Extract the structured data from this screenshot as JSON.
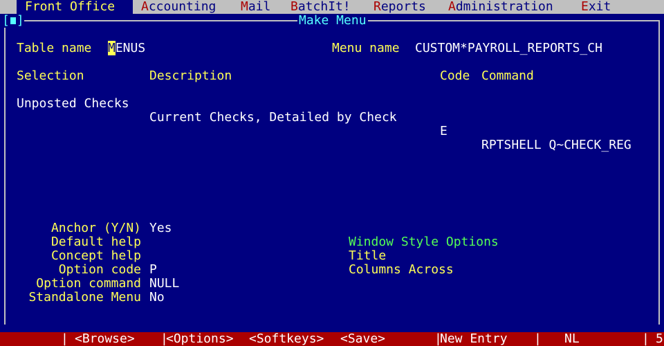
{
  "menubar": {
    "items": [
      {
        "hotkey": "F",
        "rest": "ront Office"
      },
      {
        "hotkey": "A",
        "rest": "ccounting"
      },
      {
        "hotkey": "M",
        "rest": "ail"
      },
      {
        "hotkey": "B",
        "rest": "atchIt!"
      },
      {
        "hotkey": "R",
        "rest": "eports"
      },
      {
        "hotkey": "A",
        "rest": "dministration"
      },
      {
        "hotkey": "E",
        "rest": "xit"
      }
    ]
  },
  "window": {
    "title": "Make Menu",
    "close_left": "[",
    "close_right": "]"
  },
  "form": {
    "table_name_label": "Table name",
    "table_name_cursor": "M",
    "table_name_rest": "ENUS",
    "menu_name_label": "Menu name",
    "menu_name_value": "CUSTOM*PAYROLL_REPORTS_CH"
  },
  "grid": {
    "headers": {
      "selection": "Selection",
      "description": "Description",
      "code": "Code",
      "command": "Command"
    },
    "rows": [
      {
        "selection": "Unposted Checks",
        "description": "Current Checks, Detailed by Check",
        "code": "E",
        "command": "RPTSHELL Q~CHECK_REG"
      }
    ]
  },
  "options": {
    "anchor_label": "Anchor (Y/N)",
    "anchor_value": "Yes",
    "default_help_label": "Default help",
    "default_help_value": "",
    "concept_help_label": "Concept help",
    "concept_help_value": "",
    "option_code_label": "Option code",
    "option_code_value": "P",
    "option_command_label": "Option command",
    "option_command_value": "NULL",
    "standalone_label": "Standalone Menu",
    "standalone_value": "No"
  },
  "window_style": {
    "heading": "Window Style Options",
    "title_label": "Title",
    "columns_label": "Columns Across"
  },
  "statusbar": {
    "browse": "<Browse>",
    "options": "<Options>",
    "softkeys": "<Softkeys>",
    "save": "<Save>",
    "mode": "New Entry",
    "locale": "NL",
    "page": "5",
    "sep": "|"
  }
}
